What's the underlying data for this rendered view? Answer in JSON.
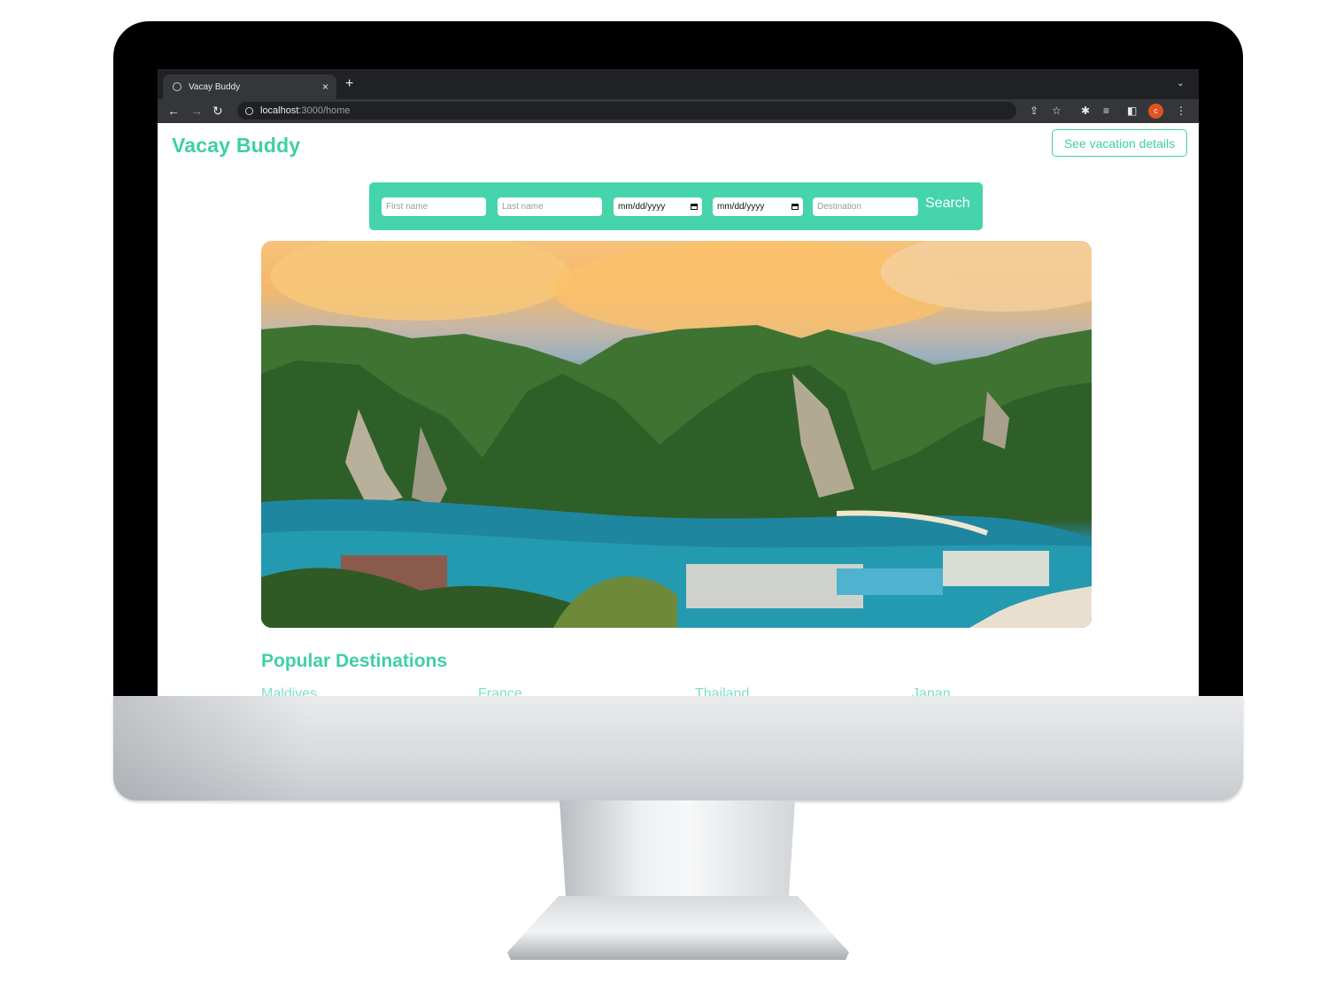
{
  "browser": {
    "tab_title": "Vacay Buddy",
    "tab_close": "×",
    "new_tab": "+",
    "tab_menu": "⌄",
    "url_host": "localhost",
    "url_path": ":3000/home",
    "avatar_letter": "c",
    "icons": [
      "back-arrow-icon",
      "forward-arrow-icon",
      "reload-icon",
      "info-icon",
      "share-icon",
      "star-icon",
      "extensions-icon",
      "media-icon",
      "side-panel-icon",
      "menu-dots-icon"
    ]
  },
  "header": {
    "brand": "Vacay Buddy",
    "details_button": "See vacation details"
  },
  "search": {
    "first_name_placeholder": "First name",
    "last_name_placeholder": "Last name",
    "start_date": "mm/dd/yyyy",
    "end_date": "mm/dd/yyyy",
    "destination_placeholder": "Destination",
    "button": "Search"
  },
  "main": {
    "section_title": "Popular Destinations",
    "destinations": [
      "Maldives",
      "France",
      "Thailand",
      "Japan"
    ]
  },
  "colors": {
    "accent": "#3fcfa6",
    "search_bar": "#45d4ab",
    "browser_dark": "#202124",
    "browser_toolbar": "#35363a"
  }
}
